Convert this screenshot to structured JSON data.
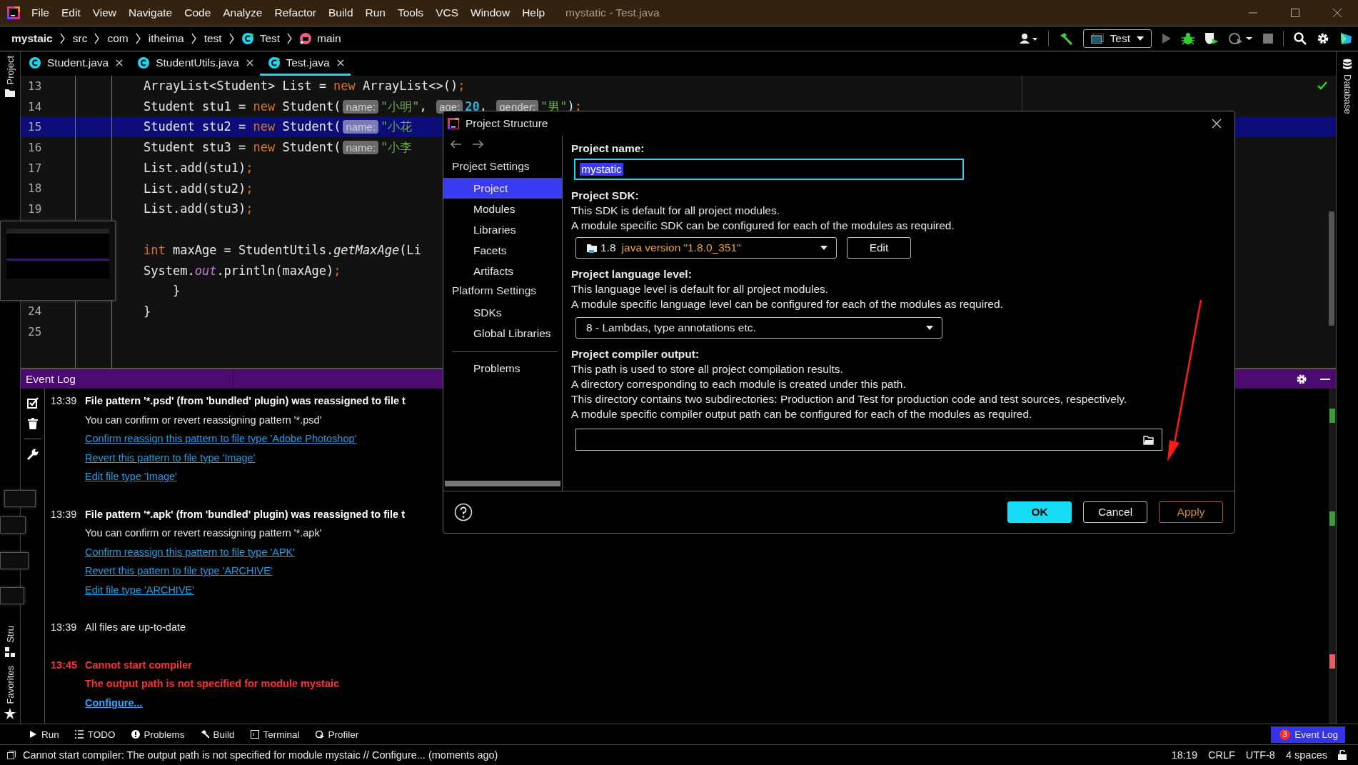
{
  "title_bar": {
    "menus": [
      {
        "label": "File"
      },
      {
        "label": "Edit"
      },
      {
        "label": "View"
      },
      {
        "label": "Navigate"
      },
      {
        "label": "Code"
      },
      {
        "label": "Analyze"
      },
      {
        "label": "Refactor"
      },
      {
        "label": "Build"
      },
      {
        "label": "Run"
      },
      {
        "label": "Tools"
      },
      {
        "label": "VCS"
      },
      {
        "label": "Window"
      },
      {
        "label": "Help"
      }
    ],
    "title": "mystatic - Test.java"
  },
  "breadcrumb": [
    {
      "label": "mystaic",
      "kind": "project"
    },
    {
      "label": "src",
      "kind": "folder"
    },
    {
      "label": "com",
      "kind": "folder"
    },
    {
      "label": "itheima",
      "kind": "folder"
    },
    {
      "label": "test",
      "kind": "folder"
    },
    {
      "label": "Test",
      "kind": "class"
    },
    {
      "label": "main",
      "kind": "method"
    }
  ],
  "run_config": {
    "label": "Test"
  },
  "editor_tabs": [
    {
      "label": "Student.java",
      "selected": false
    },
    {
      "label": "StudentUtils.java",
      "selected": false
    },
    {
      "label": "Test.java",
      "selected": true
    }
  ],
  "left_strip": {
    "top": [
      {
        "label": "Project"
      }
    ],
    "bottom": [
      {
        "label": "Stru"
      },
      {
        "label": "Favorites"
      }
    ]
  },
  "right_strip": [
    {
      "label": "Database"
    }
  ],
  "editor": {
    "lines": [
      {
        "number": "13",
        "current": false,
        "tokens": [
          {
            "kind": "plain",
            "text": "ArrayList<Student> List = "
          },
          {
            "kind": "keyword",
            "text": "new"
          },
          {
            "kind": "plain",
            "text": " ArrayList<>()"
          },
          {
            "kind": "punct",
            "text": ";"
          }
        ]
      },
      {
        "number": "14",
        "current": false,
        "tokens": [
          {
            "kind": "plain",
            "text": "Student stu1 = "
          },
          {
            "kind": "keyword",
            "text": "new"
          },
          {
            "kind": "plain",
            "text": " Student("
          },
          {
            "kind": "hint",
            "text": "name:"
          },
          {
            "kind": "string",
            "text": "\"小明\""
          },
          {
            "kind": "plain",
            "text": ", "
          },
          {
            "kind": "hint",
            "text": "age:"
          },
          {
            "kind": "number",
            "text": "20"
          },
          {
            "kind": "plain",
            "text": ", "
          },
          {
            "kind": "hint",
            "text": "gender:"
          },
          {
            "kind": "string",
            "text": "\"男\""
          },
          {
            "kind": "plain",
            "text": ")"
          },
          {
            "kind": "punct",
            "text": ";"
          }
        ]
      },
      {
        "number": "15",
        "current": true,
        "tokens": [
          {
            "kind": "plain",
            "text": "Student stu2 = "
          },
          {
            "kind": "keyword",
            "text": "new"
          },
          {
            "kind": "plain",
            "text": " Student("
          },
          {
            "kind": "hint",
            "text": "name:"
          },
          {
            "kind": "string",
            "text": "\"小花"
          }
        ]
      },
      {
        "number": "16",
        "current": false,
        "tokens": [
          {
            "kind": "plain",
            "text": "Student stu3 = "
          },
          {
            "kind": "keyword",
            "text": "new"
          },
          {
            "kind": "plain",
            "text": " Student("
          },
          {
            "kind": "hint",
            "text": "name:"
          },
          {
            "kind": "string",
            "text": "\"小李"
          }
        ]
      },
      {
        "number": "17",
        "current": false,
        "tokens": [
          {
            "kind": "plain",
            "text": "List.add(stu1)"
          },
          {
            "kind": "punct",
            "text": ";"
          }
        ]
      },
      {
        "number": "18",
        "current": false,
        "tokens": [
          {
            "kind": "plain",
            "text": "List.add(stu2)"
          },
          {
            "kind": "punct",
            "text": ";"
          }
        ]
      },
      {
        "number": "19",
        "current": false,
        "tokens": [
          {
            "kind": "plain",
            "text": "List.add(stu3)"
          },
          {
            "kind": "punct",
            "text": ";"
          }
        ]
      },
      {
        "current": false
      },
      {
        "current": false,
        "tokens": [
          {
            "kind": "keyword",
            "text": "int"
          },
          {
            "kind": "plain",
            "text": " maxAge = StudentUtils."
          },
          {
            "kind": "method",
            "text": "getMaxAge"
          },
          {
            "kind": "plain",
            "text": "(Li"
          }
        ]
      },
      {
        "current": false,
        "tokens": [
          {
            "kind": "plain",
            "text": "System."
          },
          {
            "kind": "static",
            "text": "out"
          },
          {
            "kind": "plain",
            "text": ".println(maxAge)"
          },
          {
            "kind": "punct",
            "text": ";"
          }
        ]
      },
      {
        "current": false,
        "tokens": [
          {
            "kind": "plain",
            "text": "    }"
          }
        ]
      },
      {
        "number": "24",
        "current": false,
        "tokens": [
          {
            "kind": "plain",
            "text": "}"
          }
        ]
      },
      {
        "number": "25",
        "current": false
      }
    ]
  },
  "event_log": {
    "title": "Event Log",
    "entries": [
      {
        "time": "13:39",
        "error": false,
        "lines": [
          {
            "kind": "title",
            "text": "File pattern '*.psd' (from 'bundled' plugin) was reassigned to file t"
          },
          {
            "kind": "text",
            "text": "You can confirm or revert reassigning pattern '*.psd'"
          },
          {
            "kind": "link",
            "text": "Confirm reassign this pattern to file type 'Adobe Photoshop'"
          },
          {
            "kind": "link",
            "text": "Revert this pattern to file type 'Image'"
          },
          {
            "kind": "link",
            "text": "Edit file type 'Image'"
          }
        ]
      },
      {
        "time": "13:39",
        "error": false,
        "lines": [
          {
            "kind": "title",
            "text": "File pattern '*.apk' (from 'bundled' plugin) was reassigned to file t"
          },
          {
            "kind": "text",
            "text": "You can confirm or revert reassigning pattern '*.apk'"
          },
          {
            "kind": "link",
            "text": "Confirm reassign this pattern to file type 'APK'"
          },
          {
            "kind": "link",
            "text": "Revert this pattern to file type 'ARCHIVE'"
          },
          {
            "kind": "link",
            "text": "Edit file type 'ARCHIVE'"
          }
        ]
      },
      {
        "time": "13:39",
        "error": false,
        "lines": [
          {
            "kind": "text",
            "text": "All files are up-to-date"
          }
        ]
      },
      {
        "time": "13:45",
        "error": true,
        "lines": [
          {
            "kind": "title",
            "text": "Cannot start compiler"
          },
          {
            "kind": "title",
            "text": "The output path is not specified for module mystaic"
          },
          {
            "kind": "link",
            "text": "Configure..."
          }
        ]
      }
    ]
  },
  "bottom_tools": [
    {
      "label": "Run",
      "kind": "run"
    },
    {
      "label": "TODO",
      "kind": "todo"
    },
    {
      "label": "Problems",
      "kind": "problems"
    },
    {
      "label": "Build",
      "kind": "build"
    },
    {
      "label": "Terminal",
      "kind": "terminal"
    },
    {
      "label": "Profiler",
      "kind": "profiler"
    }
  ],
  "event_log_button": {
    "badge": "3",
    "label": "Event Log",
    "selected": true
  },
  "status_bar": {
    "message": "Cannot start compiler: The output path is not specified for module mystaic // Configure... (moments ago)",
    "items": [
      "18:19",
      "CRLF",
      "UTF-8",
      "4 spaces"
    ]
  },
  "dialog": {
    "title": "Project Structure",
    "nav": [
      {
        "header": "Project Settings",
        "items": [
          {
            "label": "Project",
            "selected": true
          },
          {
            "label": "Modules",
            "selected": false
          },
          {
            "label": "Libraries",
            "selected": false
          },
          {
            "label": "Facets",
            "selected": false
          },
          {
            "label": "Artifacts",
            "selected": false
          }
        ]
      },
      {
        "header": "Platform Settings",
        "items": [
          {
            "label": "SDKs",
            "selected": false
          },
          {
            "label": "Global Libraries",
            "selected": false
          }
        ]
      },
      {
        "items": [
          {
            "label": "Problems",
            "selected": false
          }
        ]
      }
    ],
    "project_name": {
      "label": "Project name:",
      "value": "mystatic"
    },
    "sdk": {
      "label": "Project SDK:",
      "description": [
        "This SDK is default for all project modules.",
        "A module specific SDK can be configured for each of the modules as required."
      ],
      "version": "1.8",
      "detail": "java version \"1.8.0_351\"",
      "edit_button": "Edit"
    },
    "language_level": {
      "label": "Project language level:",
      "description": [
        "This language level is default for all project modules.",
        "A module specific language level can be configured for each of the modules as required."
      ],
      "value": "8 - Lambdas, type annotations etc."
    },
    "compiler_output": {
      "label": "Project compiler output:",
      "description": [
        "This path is used to store all project compilation results.",
        "A directory corresponding to each module is created under this path.",
        "This directory contains two subdirectories: Production and Test for production code and test sources, respectively.",
        "A module specific compiler output path can be configured for each of the modules as required."
      ]
    },
    "buttons": [
      {
        "label": "OK",
        "kind": "primary"
      },
      {
        "label": "Cancel",
        "kind": "secondary"
      },
      {
        "label": "Apply",
        "kind": "apply"
      }
    ]
  }
}
